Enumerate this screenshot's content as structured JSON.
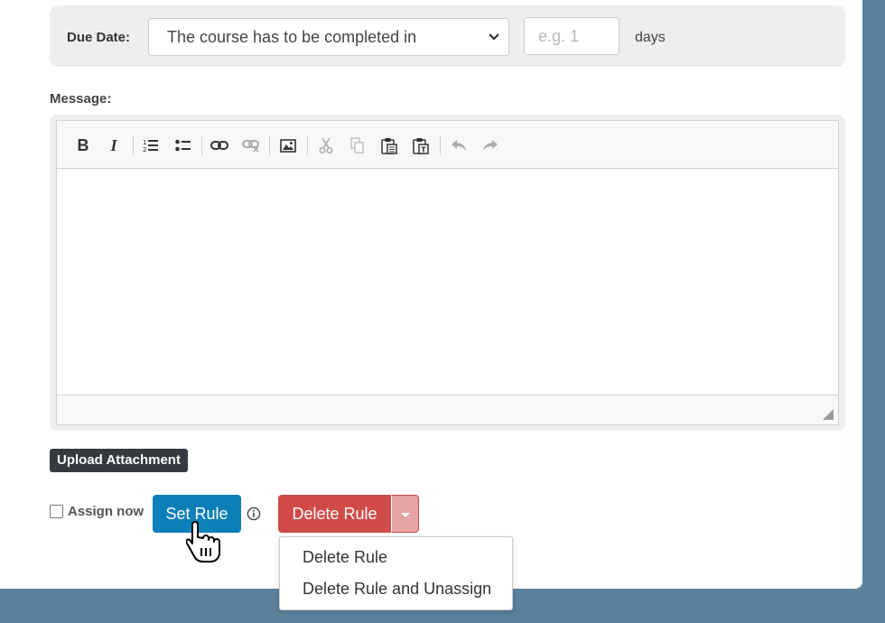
{
  "due_date": {
    "label": "Due Date:",
    "select_value": "The course has to be completed in",
    "days_placeholder": "e.g. 1",
    "days_unit": "days"
  },
  "message": {
    "label": "Message:",
    "toolbar": [
      {
        "name": "bold",
        "icon": "B"
      },
      {
        "name": "italic",
        "icon": "I"
      },
      {
        "name": "numbered-list",
        "icon": "numbered-list-icon"
      },
      {
        "name": "bulleted-list",
        "icon": "bulleted-list-icon"
      },
      {
        "name": "link",
        "icon": "link-icon"
      },
      {
        "name": "unlink",
        "icon": "unlink-icon"
      },
      {
        "name": "image",
        "icon": "image-icon"
      },
      {
        "name": "cut",
        "icon": "scissors-icon"
      },
      {
        "name": "copy",
        "icon": "copy-icon"
      },
      {
        "name": "paste",
        "icon": "paste-icon"
      },
      {
        "name": "paste-text",
        "icon": "paste-text-icon"
      },
      {
        "name": "undo",
        "icon": "undo-icon"
      },
      {
        "name": "redo",
        "icon": "redo-icon"
      }
    ]
  },
  "upload_label": "Upload Attachment",
  "assign_now_label": "Assign now",
  "assign_now_checked": false,
  "set_rule_label": "Set Rule",
  "delete_rule_label": "Delete Rule",
  "dropdown": {
    "items": [
      "Delete Rule",
      "Delete Rule and Unassign"
    ]
  },
  "colors": {
    "page_bg": "#5b809b",
    "set_rule": "#0d7fb8",
    "delete_rule": "#d04a4a",
    "upload": "#343a40"
  }
}
